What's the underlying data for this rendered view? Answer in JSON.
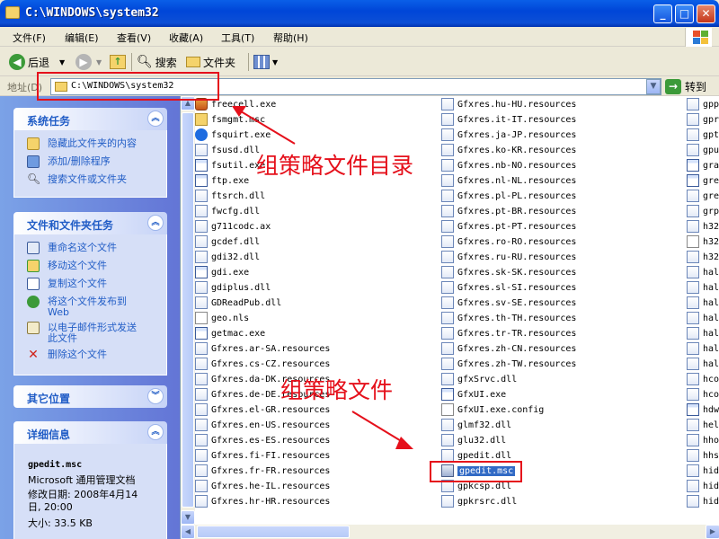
{
  "window": {
    "title": "C:\\WINDOWS\\system32",
    "buttons": {
      "minimize": "_",
      "maximize": "□",
      "close": "✕"
    }
  },
  "menu": [
    "文件(F)",
    "编辑(E)",
    "查看(V)",
    "收藏(A)",
    "工具(T)",
    "帮助(H)"
  ],
  "toolbar": {
    "back": "后退",
    "search": "搜索",
    "folders": "文件夹"
  },
  "address": {
    "label": "地址(D)",
    "value": "C:\\WINDOWS\\system32",
    "go": "转到"
  },
  "sidebar": {
    "system_tasks": {
      "title": "系统任务",
      "items": [
        "隐藏此文件夹的内容",
        "添加/删除程序",
        "搜索文件或文件夹"
      ]
    },
    "file_tasks": {
      "title": "文件和文件夹任务",
      "items": [
        "重命名这个文件",
        "移动这个文件",
        "复制这个文件",
        "将这个文件发布到",
        "Web",
        "以电子邮件形式发送",
        "此文件",
        "删除这个文件"
      ]
    },
    "other_places": {
      "title": "其它位置"
    },
    "details": {
      "title": "详细信息",
      "filename": "gpedit.msc",
      "type": "Microsoft 通用管理文档",
      "modified_label": "修改日期: 2008年4月14",
      "modified_time": "日, 20:00",
      "size": "大小: 33.5 KB"
    }
  },
  "files": {
    "col1": [
      {
        "name": "freecell.exe",
        "icon": "game"
      },
      {
        "name": "fsmgmt.msc",
        "icon": "folder"
      },
      {
        "name": "fsquirt.exe",
        "icon": "bt"
      },
      {
        "name": "fsusd.dll",
        "icon": "dll"
      },
      {
        "name": "fsutil.exe",
        "icon": "exe"
      },
      {
        "name": "ftp.exe",
        "icon": "exe"
      },
      {
        "name": "ftsrch.dll",
        "icon": "dll"
      },
      {
        "name": "fwcfg.dll",
        "icon": "dll"
      },
      {
        "name": "g711codc.ax",
        "icon": "dll"
      },
      {
        "name": "gcdef.dll",
        "icon": "dll"
      },
      {
        "name": "gdi32.dll",
        "icon": "dll"
      },
      {
        "name": "gdi.exe",
        "icon": "exe"
      },
      {
        "name": "gdiplus.dll",
        "icon": "dll"
      },
      {
        "name": "GDReadPub.dll",
        "icon": "dll"
      },
      {
        "name": "geo.nls",
        "icon": "doc"
      },
      {
        "name": "getmac.exe",
        "icon": "exe"
      },
      {
        "name": "Gfxres.ar-SA.resources",
        "icon": "dll"
      },
      {
        "name": "Gfxres.cs-CZ.resources",
        "icon": "dll"
      },
      {
        "name": "Gfxres.da-DK.resources",
        "icon": "dll"
      },
      {
        "name": "Gfxres.de-DE.resources",
        "icon": "dll"
      },
      {
        "name": "Gfxres.el-GR.resources",
        "icon": "dll"
      },
      {
        "name": "Gfxres.en-US.resources",
        "icon": "dll"
      },
      {
        "name": "Gfxres.es-ES.resources",
        "icon": "dll"
      },
      {
        "name": "Gfxres.fi-FI.resources",
        "icon": "dll"
      },
      {
        "name": "Gfxres.fr-FR.resources",
        "icon": "dll"
      },
      {
        "name": "Gfxres.he-IL.resources",
        "icon": "dll"
      },
      {
        "name": "Gfxres.hr-HR.resources",
        "icon": "dll"
      }
    ],
    "col2": [
      {
        "name": "Gfxres.hu-HU.resources",
        "icon": "dll"
      },
      {
        "name": "Gfxres.it-IT.resources",
        "icon": "dll"
      },
      {
        "name": "Gfxres.ja-JP.resources",
        "icon": "dll"
      },
      {
        "name": "Gfxres.ko-KR.resources",
        "icon": "dll"
      },
      {
        "name": "Gfxres.nb-NO.resources",
        "icon": "dll"
      },
      {
        "name": "Gfxres.nl-NL.resources",
        "icon": "dll"
      },
      {
        "name": "Gfxres.pl-PL.resources",
        "icon": "dll"
      },
      {
        "name": "Gfxres.pt-BR.resources",
        "icon": "dll"
      },
      {
        "name": "Gfxres.pt-PT.resources",
        "icon": "dll"
      },
      {
        "name": "Gfxres.ro-RO.resources",
        "icon": "dll"
      },
      {
        "name": "Gfxres.ru-RU.resources",
        "icon": "dll"
      },
      {
        "name": "Gfxres.sk-SK.resources",
        "icon": "dll"
      },
      {
        "name": "Gfxres.sl-SI.resources",
        "icon": "dll"
      },
      {
        "name": "Gfxres.sv-SE.resources",
        "icon": "dll"
      },
      {
        "name": "Gfxres.th-TH.resources",
        "icon": "dll"
      },
      {
        "name": "Gfxres.tr-TR.resources",
        "icon": "dll"
      },
      {
        "name": "Gfxres.zh-CN.resources",
        "icon": "dll"
      },
      {
        "name": "Gfxres.zh-TW.resources",
        "icon": "dll"
      },
      {
        "name": "gfxSrvc.dll",
        "icon": "dll"
      },
      {
        "name": "GfxUI.exe",
        "icon": "exe"
      },
      {
        "name": "GfxUI.exe.config",
        "icon": "doc"
      },
      {
        "name": "glmf32.dll",
        "icon": "dll"
      },
      {
        "name": "glu32.dll",
        "icon": "dll"
      },
      {
        "name": "gpedit.dll",
        "icon": "dll"
      },
      {
        "name": "gpedit.msc",
        "icon": "msc",
        "selected": true
      },
      {
        "name": "gpkcsp.dll",
        "icon": "dll"
      },
      {
        "name": "gpkrsrc.dll",
        "icon": "dll"
      }
    ],
    "col3": [
      {
        "name": "gpp",
        "icon": "dll"
      },
      {
        "name": "gpr",
        "icon": "dll"
      },
      {
        "name": "gpt",
        "icon": "dll"
      },
      {
        "name": "gpu",
        "icon": "dll"
      },
      {
        "name": "gra",
        "icon": "exe"
      },
      {
        "name": "gre",
        "icon": "exe"
      },
      {
        "name": "gre",
        "icon": "dll"
      },
      {
        "name": "grp",
        "icon": "dll"
      },
      {
        "name": "h32",
        "icon": "dll"
      },
      {
        "name": "h32",
        "icon": "doc"
      },
      {
        "name": "h32",
        "icon": "dll"
      },
      {
        "name": "hal",
        "icon": "dll"
      },
      {
        "name": "hal",
        "icon": "dll"
      },
      {
        "name": "hal",
        "icon": "dll"
      },
      {
        "name": "hal",
        "icon": "dll"
      },
      {
        "name": "hal",
        "icon": "dll"
      },
      {
        "name": "hal",
        "icon": "dll"
      },
      {
        "name": "hal",
        "icon": "dll"
      },
      {
        "name": "hco",
        "icon": "dll"
      },
      {
        "name": "hco",
        "icon": "dll"
      },
      {
        "name": "hdw",
        "icon": "exe"
      },
      {
        "name": "hel",
        "icon": "dll"
      },
      {
        "name": "hho",
        "icon": "dll"
      },
      {
        "name": "hhs",
        "icon": "dll"
      },
      {
        "name": "hid",
        "icon": "dll"
      },
      {
        "name": "hid",
        "icon": "dll"
      },
      {
        "name": "hid",
        "icon": "dll"
      }
    ]
  },
  "annotations": {
    "dir_label": "组策略文件目录",
    "file_label": "组策略文件",
    "color": "#E5101B"
  }
}
